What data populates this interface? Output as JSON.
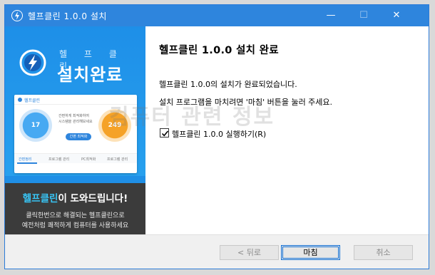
{
  "window": {
    "title": "헬프클린 1.0.0 설치",
    "controls": {
      "minimize": "—",
      "maximize": "☐",
      "close": "✕"
    },
    "accent_color": "#2e85dd"
  },
  "sidebar": {
    "brand_spaced": "헬 프 클 린",
    "brand_title": "설치완료",
    "mock_app": {
      "header": "헬프클린",
      "left_gauge_value": "17",
      "right_gauge_value": "249",
      "lines": [
        "간편하게 최적화하여",
        "시스템을 관리해보세요"
      ],
      "button": "간편 최적화",
      "tabs": [
        "간편정리",
        "프로그램 관리",
        "PC최적화",
        "프로그램 관리"
      ]
    },
    "help_title_accent": "헬프클린",
    "help_title_rest": "이 도와드립니다!",
    "help_line1": "클릭한번으로 해결되는 헬프클린으로",
    "help_line2": "예전처럼 쾌적하게 컴퓨터를 사용하세요"
  },
  "content": {
    "heading": "헬프클린 1.0.0 설치 완료",
    "line1": "헬프클린 1.0.0의 설치가 완료되었습니다.",
    "line2": "설치 프로그램을 마치려면 '마침' 버튼을 눌러 주세요.",
    "run_checkbox": {
      "label": "헬프클린 1.0.0 실행하기(R)",
      "checked": true
    }
  },
  "watermark": "컴퓨터 관련 정보",
  "buttons": {
    "back": "< 뒤로",
    "finish": "마침",
    "cancel": "취소"
  }
}
